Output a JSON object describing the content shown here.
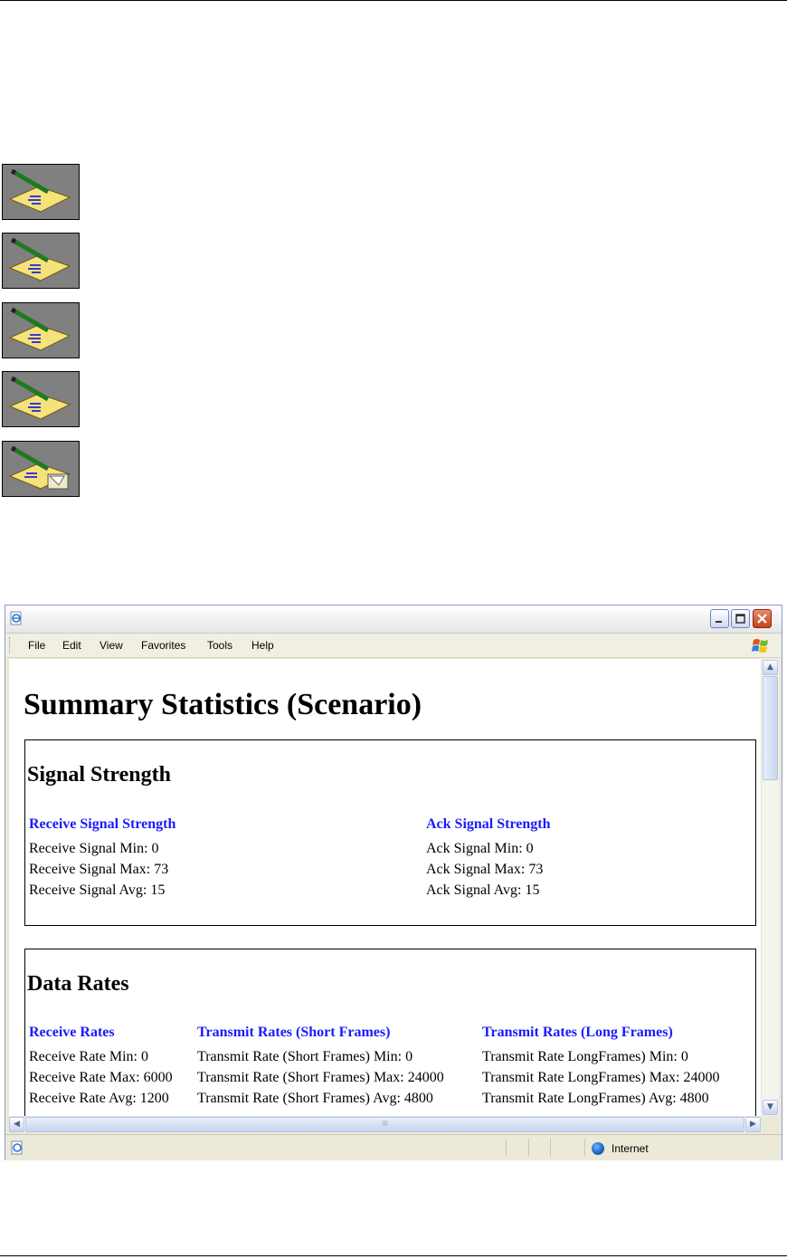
{
  "window": {
    "menu": [
      "File",
      "Edit",
      "View",
      "Favorites",
      "Tools",
      "Help"
    ],
    "status_zone": "Internet",
    "hscroll_grip": "III"
  },
  "page": {
    "title": "Summary Statistics (Scenario)",
    "signal_strength": {
      "heading": "Signal Strength",
      "receive": {
        "heading": "Receive Signal Strength",
        "lines": [
          "Receive Signal Min: 0",
          "Receive Signal Max: 73",
          "Receive Signal Avg: 15"
        ]
      },
      "ack": {
        "heading": "Ack Signal Strength",
        "lines": [
          "Ack Signal Min: 0",
          "Ack Signal Max: 73",
          "Ack Signal Avg: 15"
        ]
      }
    },
    "data_rates": {
      "heading": "Data Rates",
      "receive": {
        "heading": "Receive Rates",
        "lines": [
          "Receive Rate Min: 0",
          "Receive Rate Max: 6000",
          "Receive Rate Avg: 1200"
        ]
      },
      "short": {
        "heading": "Transmit Rates (Short Frames)",
        "lines": [
          "Transmit Rate (Short Frames) Min: 0",
          "Transmit Rate (Short Frames) Max: 24000",
          "Transmit Rate (Short Frames) Avg: 4800"
        ]
      },
      "long": {
        "heading": "Transmit Rates (Long Frames)",
        "lines": [
          "Transmit Rate LongFrames) Min: 0",
          "Transmit Rate LongFrames) Max: 24000",
          "Transmit Rate LongFrames) Avg: 4800"
        ]
      }
    }
  },
  "icons": [
    "notepad-pencil-icon",
    "notepad-pencil-icon",
    "notepad-pencil-icon",
    "notepad-pencil-icon",
    "notepad-pencil-folder-icon"
  ]
}
